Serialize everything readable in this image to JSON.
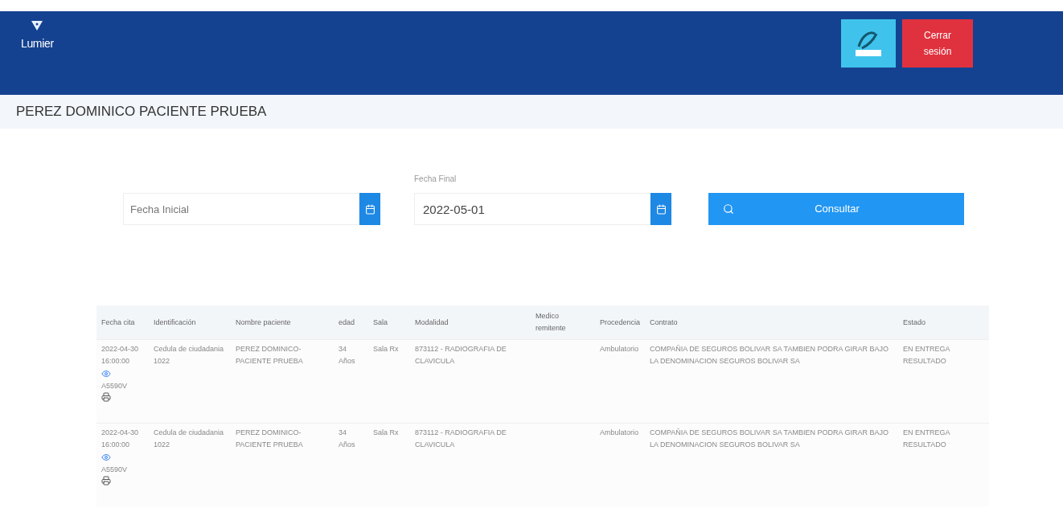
{
  "navbar": {
    "brand": "Lumier",
    "logout_button": "Cerrar sesión"
  },
  "patient": {
    "name": "PEREZ DOMINICO PACIENTE PRUEBA"
  },
  "filters": {
    "start_date": {
      "placeholder": "Fecha Inicial"
    },
    "end_date": {
      "label": "Fecha Final",
      "value": "2022-05-01"
    },
    "search_button": "Consultar"
  },
  "table": {
    "columns": [
      "Fecha cita",
      "Identificación",
      "Nombre paciente",
      "edad",
      "Sala",
      "Modalidad",
      "Medico remitente",
      "Procedencia",
      "Contrato",
      "Estado"
    ],
    "rows": [
      {
        "date": "2022-04-30 16:00:00",
        "code": "A5590V",
        "identification": "Cedula de ciudadania 1022",
        "name": "PEREZ DOMINICO-PACIENTE PRUEBA",
        "age": "34 Años",
        "room": "Sala Rx",
        "modality": "873112 - RADIOGRAFIA DE CLAVICULA",
        "doctor": "",
        "origin": "Ambulatorio",
        "contract": "COMPAÑIA DE SEGUROS BOLIVAR SA TAMBIEN PODRA GIRAR BAJO LA DENOMINACION SEGUROS BOLIVAR SA",
        "status": "EN ENTREGA RESULTADO"
      },
      {
        "date": "2022-04-30 16:00:00",
        "code": "A5590V",
        "identification": "Cedula de ciudadania 1022",
        "name": "PEREZ DOMINICO-PACIENTE PRUEBA",
        "age": "34 Años",
        "room": "Sala Rx",
        "modality": "873112 - RADIOGRAFIA DE CLAVICULA",
        "doctor": "",
        "origin": "Ambulatorio",
        "contract": "COMPAÑIA DE SEGUROS BOLIVAR SA TAMBIEN PODRA GIRAR BAJO LA DENOMINACION SEGUROS BOLIVAR SA",
        "status": "EN ENTREGA RESULTADO"
      }
    ]
  }
}
